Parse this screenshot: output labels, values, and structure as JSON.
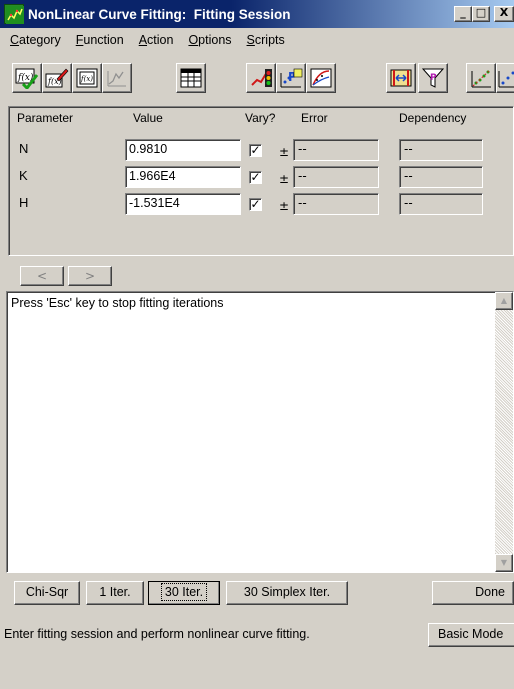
{
  "window": {
    "title": "NonLinear Curve Fitting:  Fitting Session",
    "minimize_glyph": "_",
    "maximize_glyph": "□",
    "close_glyph": "X"
  },
  "menu": {
    "items": [
      {
        "label": "Category",
        "accel_index": 0
      },
      {
        "label": "Function",
        "accel_index": 0
      },
      {
        "label": "Action",
        "accel_index": 0
      },
      {
        "label": "Options",
        "accel_index": 0
      },
      {
        "label": "Scripts",
        "accel_index": 0
      }
    ]
  },
  "toolbar": {
    "buttons": [
      "function-check-icon",
      "function-edit-icon",
      "function-graph-icon",
      "simulate-icon",
      "worksheet-icon",
      "traffic-light-icon",
      "parameters-icon",
      "fit-curve-icon",
      "range-icon",
      "filter-icon",
      "result-scatter-icon",
      "result-fit-icon"
    ]
  },
  "parameters": {
    "headers": {
      "parameter": "Parameter",
      "value": "Value",
      "vary": "Vary?",
      "error": "Error",
      "dependency": "Dependency"
    },
    "rows": [
      {
        "name": "N",
        "value": "0.9810",
        "vary": true,
        "pm": "±",
        "error": "--",
        "dependency": "--"
      },
      {
        "name": "K",
        "value": "1.966E4",
        "vary": true,
        "pm": "±",
        "error": "--",
        "dependency": "--"
      },
      {
        "name": "H",
        "value": "-1.531E4",
        "vary": true,
        "pm": "±",
        "error": "--",
        "dependency": "--"
      }
    ]
  },
  "nav": {
    "prev": "<",
    "next": ">"
  },
  "message": {
    "text": "Press 'Esc' key to stop fitting iterations",
    "scroll_up": "▲",
    "scroll_down": "▼"
  },
  "actions": {
    "chisqr": "Chi-Sqr",
    "one_iter": "1 Iter.",
    "thirty_iter": "30 Iter.",
    "simplex": "30 Simplex Iter.",
    "done": "Done"
  },
  "status": {
    "text": "Enter fitting session and perform nonlinear curve fitting.",
    "basic_mode": "Basic Mode"
  },
  "colors": {
    "title_bar_start": "#0a246a",
    "title_bar_end": "#a6caf0",
    "face": "#d4d0c8"
  }
}
